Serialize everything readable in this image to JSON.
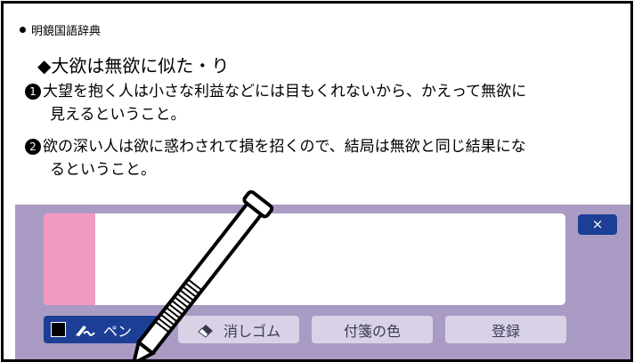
{
  "dictionary": {
    "name": "明鏡国語辞典"
  },
  "entry": {
    "headword": "◆大欲は無欲に似た・り",
    "definitions": [
      {
        "number": "1",
        "line1": "大望を抱く人は小さな利益などには目もくれないから、かえって無欲に",
        "line2": "見えるということ。"
      },
      {
        "number": "2",
        "line1": "欲の深い人は欲に惑わされて損を招くので、結局は無欲と同じ結果にな",
        "line2": "るということ。"
      }
    ]
  },
  "toolbar": {
    "close_label": "×",
    "pen_label": "ペン",
    "eraser_label": "消しゴム",
    "sticky_color_label": "付箋の色",
    "register_label": "登録"
  },
  "colors": {
    "tray": "#a99bc3",
    "sticky_note": "#f39ac3",
    "active_button": "#1c3f95",
    "inactive_button": "#d9d2e7"
  },
  "icons": [
    "bullet-icon",
    "pen-icon",
    "eraser-icon",
    "close-icon",
    "stylus-icon"
  ]
}
